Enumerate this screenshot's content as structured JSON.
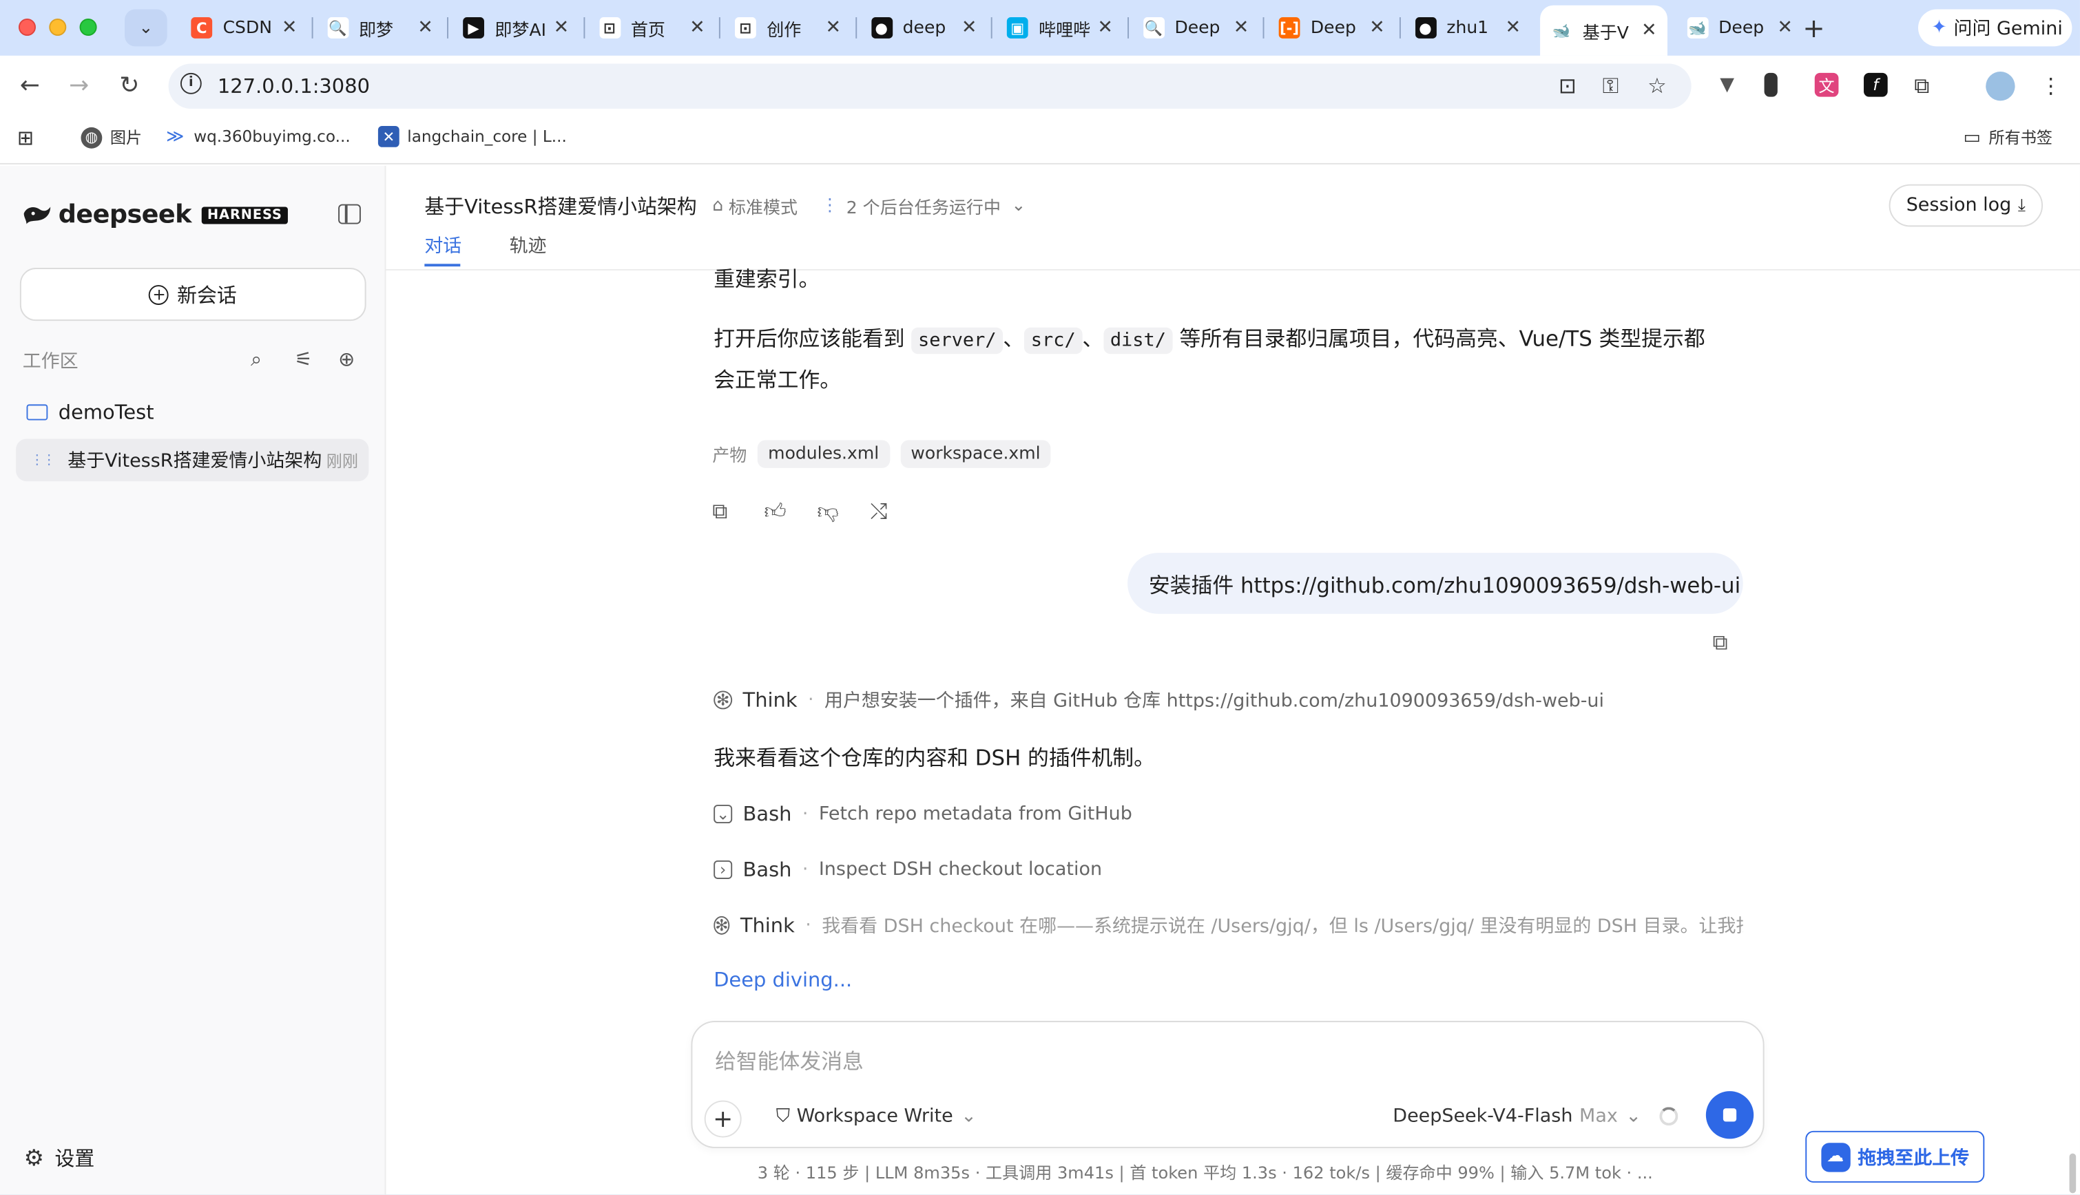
{
  "browser": {
    "tabs": [
      {
        "label": "CSDN",
        "favicon_color": "#fc5531",
        "glyph": "C"
      },
      {
        "label": "即梦",
        "favicon_color": "#ffffff",
        "glyph": "🔍"
      },
      {
        "label": "即梦AI",
        "favicon_color": "#111111",
        "glyph": "▶"
      },
      {
        "label": "首页",
        "favicon_color": "#ffffff",
        "glyph": "⊡"
      },
      {
        "label": "创作",
        "favicon_color": "#ffffff",
        "glyph": "⊡"
      },
      {
        "label": "deep",
        "favicon_color": "#111111",
        "glyph": "●"
      },
      {
        "label": "哔哩哔",
        "favicon_color": "#00aeec",
        "glyph": "▣"
      },
      {
        "label": "Deep",
        "favicon_color": "#ffffff",
        "glyph": "🔍"
      },
      {
        "label": "Deep",
        "favicon_color": "#ff6a00",
        "glyph": "[-]"
      },
      {
        "label": "zhu1",
        "favicon_color": "#111111",
        "glyph": "●"
      },
      {
        "label": "基于V",
        "favicon_color": "#ffffff",
        "glyph": "🐋",
        "active": true
      },
      {
        "label": "Deep",
        "favicon_color": "#ffffff",
        "glyph": "🐋"
      }
    ],
    "gemini_label": "问问 Gemini",
    "url": "127.0.0.1:3080",
    "bookmarks": [
      {
        "label": "图片"
      },
      {
        "label": "wq.360buyimg.co..."
      },
      {
        "label": "langchain_core | L..."
      }
    ],
    "all_bookmarks": "所有书签"
  },
  "sidebar": {
    "brand": "deepseek",
    "badge": "HARNESS",
    "new_chat": "新会话",
    "workspace_label": "工作区",
    "folder": "demoTest",
    "session": {
      "title": "基于VitessR搭建爱情小站架构",
      "time": "刚刚"
    },
    "settings": "设置"
  },
  "header": {
    "title": "基于VitessR搭建爱情小站架构",
    "mode": "标准模式",
    "tasks": "2 个后台任务运行中",
    "session_log": "Session log",
    "tabs": [
      {
        "label": "对话",
        "active": true
      },
      {
        "label": "轨迹",
        "active": false
      }
    ]
  },
  "conversation": {
    "line_rebuild": "重建索引。",
    "para_prefix": "打开后你应该能看到",
    "code1": "server/",
    "code2": "src/",
    "code3": "dist/",
    "sep": "、",
    "para_suffix": "等所有目录都归属项目，代码高亮、Vue/TS 类型提示都",
    "para_line2": "会正常工作。",
    "artifacts_label": "产物",
    "artifacts": [
      "modules.xml",
      "workspace.xml"
    ],
    "user_message": "安装插件 https://github.com/zhu1090093659/dsh-web-ui",
    "steps": [
      {
        "name": "Think",
        "desc": "用户想安装一个插件，来自 GitHub 仓库 https://github.com/zhu1090093659/dsh-web-ui"
      },
      {
        "name": "Bash",
        "desc": "Fetch repo metadata from GitHub"
      },
      {
        "name": "Bash",
        "desc": "Inspect DSH checkout location"
      },
      {
        "name": "Think",
        "desc": "我看看 DSH checkout 在哪——系统提示说在 /Users/gjq/，但 ls /Users/gjq/ 里没有明显的 DSH 目录。让我找"
      }
    ],
    "reply": "我来看看这个仓库的内容和 DSH 的插件机制。",
    "status": "Deep diving..."
  },
  "composer": {
    "placeholder": "给智能体发消息",
    "permission": "Workspace Write",
    "model": "DeepSeek-V4-Flash",
    "effort": "Max",
    "stats": "3 轮 · 115 步   |   LLM 8m35s · 工具调用 3m41s   |   首 token 平均 1.3s · 162 tok/s   |   缓存命中 99%   |   输入 5.7M tok · ..."
  },
  "upload_widget": "拖拽至此上传",
  "colors": {
    "accent": "#3b73e0",
    "stop": "#2e68e6",
    "tabstrip": "#d3e3fd"
  }
}
